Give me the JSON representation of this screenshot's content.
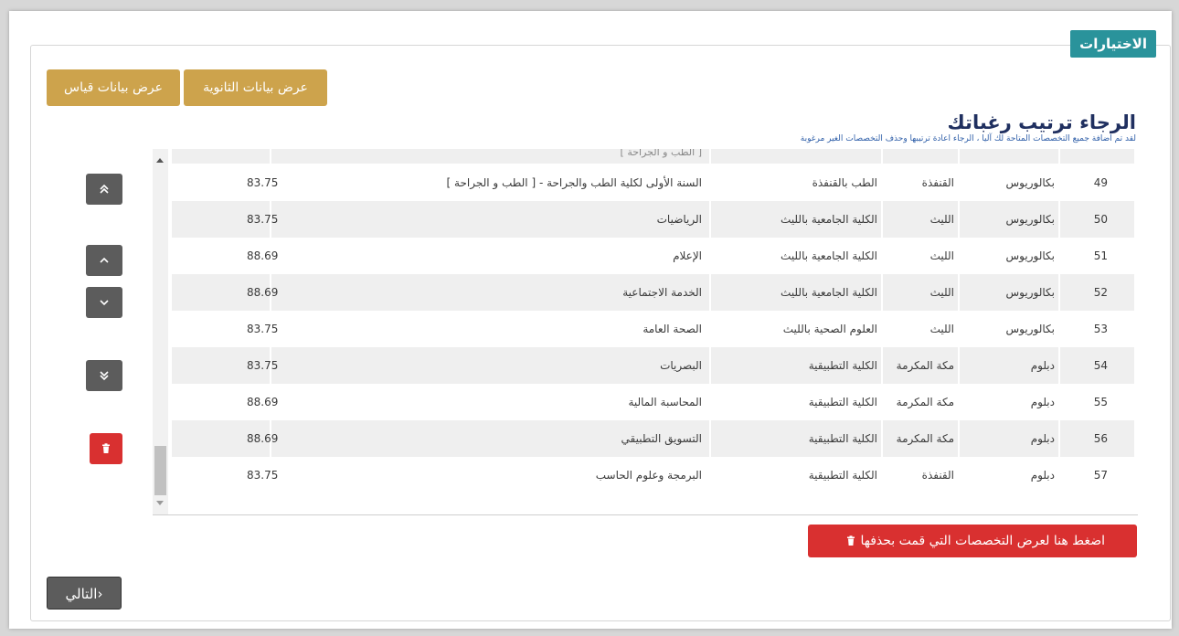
{
  "section_title": "الاختيارات",
  "buttons": {
    "show_secondary": "عرض بيانات الثانوية",
    "show_qiyas": "عرض بيانات قياس",
    "show_deleted": "اضغط هنا لعرض التخصصات التي قمت بحذفها",
    "next": "التالي›"
  },
  "heading": "الرجاء ترتيب رغباتك",
  "subheading": "لقد تم اضافة جميع التخصصات المتاحة لك آليا ، الرجاء اعادة ترتيبها وحذف التخصصات الغير مرغوبة",
  "partial_row_text": "[ الطب و الجراحة ]",
  "rows": [
    {
      "num": "49",
      "degree": "بكالوريوس",
      "city": "القنفذة",
      "college": "الطب بالقنفذة",
      "program": "السنة الأولى لكلية الطب والجراحة - [ الطب و الجراحة ]",
      "score": "83.75"
    },
    {
      "num": "50",
      "degree": "بكالوريوس",
      "city": "الليث",
      "college": "الكلية الجامعية بالليث",
      "program": "الرياضيات",
      "score": "83.75"
    },
    {
      "num": "51",
      "degree": "بكالوريوس",
      "city": "الليث",
      "college": "الكلية الجامعية بالليث",
      "program": "الإعلام",
      "score": "88.69"
    },
    {
      "num": "52",
      "degree": "بكالوريوس",
      "city": "الليث",
      "college": "الكلية الجامعية بالليث",
      "program": "الخدمة الاجتماعية",
      "score": "88.69"
    },
    {
      "num": "53",
      "degree": "بكالوريوس",
      "city": "الليث",
      "college": "العلوم الصحية بالليث",
      "program": "الصحة العامة",
      "score": "83.75"
    },
    {
      "num": "54",
      "degree": "دبلوم",
      "city": "مكة المكرمة",
      "college": "الكلية التطبيقية",
      "program": "البصريات",
      "score": "83.75"
    },
    {
      "num": "55",
      "degree": "دبلوم",
      "city": "مكة المكرمة",
      "college": "الكلية التطبيقية",
      "program": "المحاسبة المالية",
      "score": "88.69"
    },
    {
      "num": "56",
      "degree": "دبلوم",
      "city": "مكة المكرمة",
      "college": "الكلية التطبيقية",
      "program": "التسويق التطبيقي",
      "score": "88.69"
    },
    {
      "num": "57",
      "degree": "دبلوم",
      "city": "القنفذة",
      "college": "الكلية التطبيقية",
      "program": "البرمجة وعلوم الحاسب",
      "score": "83.75"
    }
  ],
  "icons": {
    "top": "double-chevron-up-icon",
    "up": "chevron-up-icon",
    "down": "chevron-down-icon",
    "bottom": "double-chevron-down-icon",
    "delete": "trash-icon"
  },
  "colors": {
    "teal": "#2a939b",
    "gold": "#cda34c",
    "red": "#d93030",
    "dark": "#5c5c5c"
  }
}
